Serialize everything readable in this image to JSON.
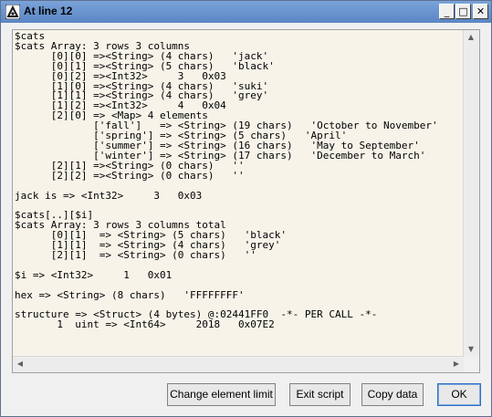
{
  "window": {
    "title": "At line 12",
    "controls": {
      "minimize": "_",
      "maximize": "□",
      "close": "✕"
    }
  },
  "output": {
    "lines": [
      "$cats",
      "$cats Array: 3 rows 3 columns",
      "      [0][0] =><String> (4 chars)   'jack'",
      "      [0][1] =><String> (5 chars)   'black'",
      "      [0][2] =><Int32>     3   0x03",
      "      [1][0] =><String> (4 chars)   'suki'",
      "      [1][1] =><String> (4 chars)   'grey'",
      "      [1][2] =><Int32>     4   0x04",
      "      [2][0] => <Map> 4 elements",
      "             ['fall']   => <String> (19 chars)   'October to November'",
      "             ['spring'] => <String> (5 chars)   'April'",
      "             ['summer'] => <String> (16 chars)   'May to September'",
      "             ['winter'] => <String> (17 chars)   'December to March'",
      "      [2][1] =><String> (0 chars)   ''",
      "      [2][2] =><String> (0 chars)   ''",
      "",
      "jack is => <Int32>     3   0x03",
      "",
      "$cats[..][$i]",
      "$cats Array: 3 rows 3 columns total",
      "      [0][1]  => <String> (5 chars)   'black'",
      "      [1][1]  => <String> (4 chars)   'grey'",
      "      [2][1]  => <String> (0 chars)   ''",
      "",
      "$i => <Int32>     1   0x01",
      "",
      "hex => <String> (8 chars)   'FFFFFFFF'",
      "",
      "structure => <Struct> (4 bytes) @:02441FF0  -*- PER CALL -*-",
      "       1  uint => <Int64>     2018   0x07E2"
    ]
  },
  "scrollbar": {
    "up": "▲",
    "down": "▼",
    "left": "◀",
    "right": "▶"
  },
  "buttons": {
    "change_element_limit": "Change element limit",
    "exit_script": "Exit script",
    "copy_data": "Copy data",
    "ok": "OK"
  }
}
